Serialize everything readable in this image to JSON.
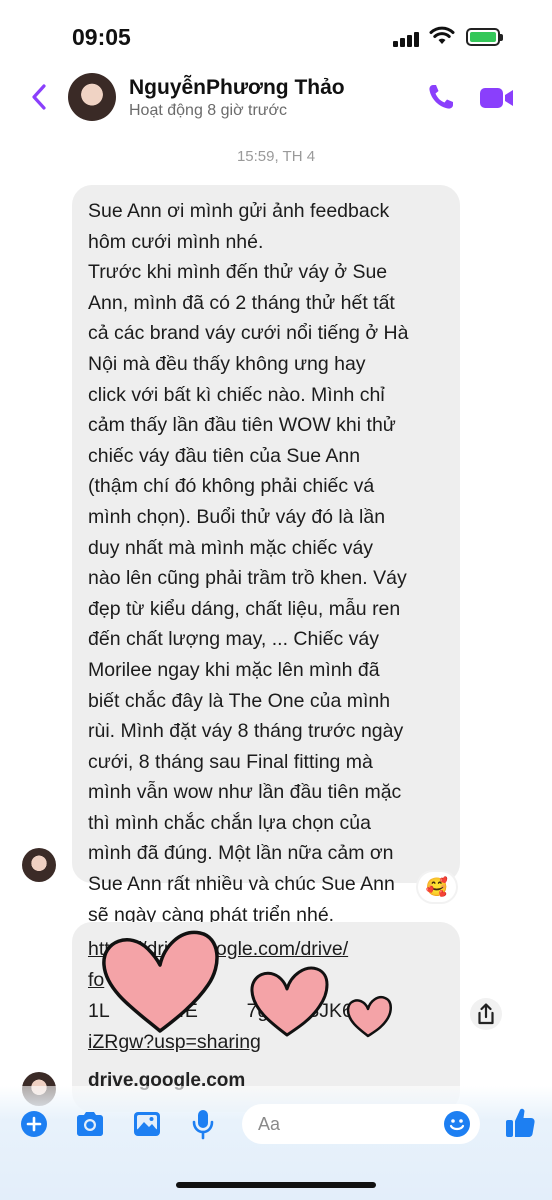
{
  "status_bar": {
    "time": "09:05"
  },
  "header": {
    "name": "NguyễnPhương Thảo",
    "status": "Hoạt động 8 giờ trước"
  },
  "chat": {
    "timestamp": "15:59, TH 4",
    "message_text": "Sue Ann ơi mình gửi ảnh feedback\nhôm cưới mình nhé.\nTrước khi mình đến thử váy ở Sue\nAnn, mình đã có 2 tháng thử hết tất\ncả các brand váy cưới nổi tiếng ở Hà\nNội mà đều thấy không ưng hay\nclick với bất kì chiếc nào. Mình chỉ\ncảm thấy lần đầu tiên WOW khi thử\nchiếc váy đầu tiên của Sue Ann\n(thậm chí đó không phải chiếc vá\nmình chọn). Buổi thử váy đó là lần\nduy nhất mà mình mặc chiếc váy\nnào lên cũng phải trầm trồ khen. Váy\nđẹp từ kiểu dáng, chất liệu, mẫu ren\nđến chất lượng may, ...  Chiếc váy\nMorilee ngay khi mặc lên mình đã\nbiết chắc đây là The One của mình\nrùi. Mình đặt váy 8 tháng trước ngày\ncưới, 8 tháng sau Final fitting mà\nmình vẫn wow như lần đầu tiên mặc\nthì mình chắc chắn lựa chọn của\nmình đã đúng. Một lần nữa cảm ơn\nSue Ann rất nhiều và chúc Sue Ann\nsẽ ngày càng phát triển nhé.",
    "reaction": "🥰",
    "link_lines": [
      "https://drive.google.com/drive/",
      "fo",
      "1L          04E         7gKM  3JK6",
      "iZRgw?usp=sharing"
    ],
    "link_site": "drive.google.com"
  },
  "composer": {
    "placeholder": "Aa"
  },
  "colors": {
    "accent": "#8a3ffc",
    "composer_blue": "#1d7ff2",
    "bubble": "#eeeeee"
  },
  "icons": [
    "back-icon",
    "phone-icon",
    "video-icon",
    "share-icon",
    "plus-icon",
    "camera-icon",
    "image-icon",
    "mic-icon",
    "emoji-icon",
    "thumbs-up-icon"
  ]
}
